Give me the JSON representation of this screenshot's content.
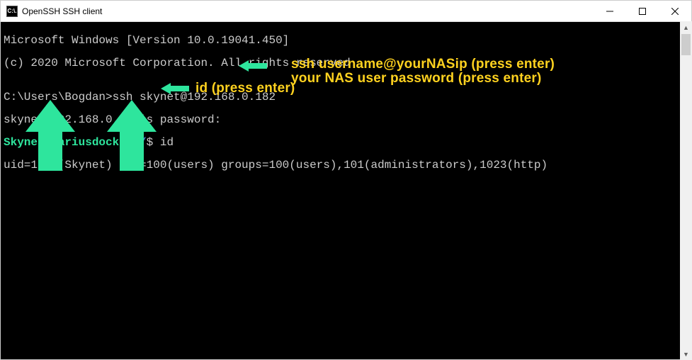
{
  "window": {
    "title": "OpenSSH SSH client",
    "icon_text": "C:\\."
  },
  "terminal": {
    "line1": "Microsoft Windows [Version 10.0.19041.450]",
    "line2": "(c) 2020 Microsoft Corporation. All rights reserved.",
    "blank": "",
    "prompt1_prefix": "C:\\Users\\Bogdan>",
    "prompt1_cmd": "ssh skynet@192.168.0.182",
    "line_pw": "skynet@192.168.0.182's password:",
    "prompt2_user": "Skynet@Mariusdocker",
    "prompt2_colon": ":",
    "prompt2_path": "/",
    "prompt2_dollar": "$ ",
    "prompt2_cmd": "id",
    "line_out": "uid=1026(Skynet) gid=100(users) groups=100(users),101(administrators),1023(http)"
  },
  "annotations": {
    "a1": "ssh username@yourNASip (press enter)",
    "a2": "your NAS user password (press enter)",
    "a3": "id (press enter)"
  },
  "colors": {
    "annotation": "#ffd21f",
    "arrow": "#2ee59d",
    "prompt_green": "#2ee59d",
    "prompt_blue": "#4a8cd8"
  }
}
